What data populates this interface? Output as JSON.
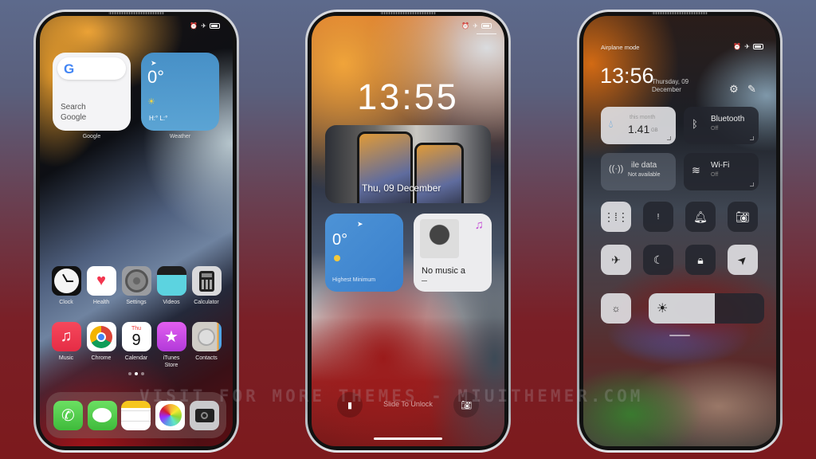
{
  "status_icons": [
    "alarm-icon",
    "airplane-icon",
    "battery-icon"
  ],
  "watermark": "VISIT FOR MORE THEMES - MIUITHEMER.COM",
  "home": {
    "google_widget": {
      "logo": "G",
      "text": "Search\nGoogle",
      "label": "Google"
    },
    "weather_widget": {
      "temp": "0°",
      "hl": "H:° L:°",
      "label": "Weather"
    },
    "apps_row1": [
      {
        "name": "Clock",
        "icon": "clock-icon"
      },
      {
        "name": "Health",
        "icon": "heart-icon"
      },
      {
        "name": "Settings",
        "icon": "gear-icon"
      },
      {
        "name": "Videos",
        "icon": "clapperboard-icon"
      },
      {
        "name": "Calculator",
        "icon": "calculator-icon"
      }
    ],
    "apps_row2": [
      {
        "name": "Music",
        "icon": "music-note-icon"
      },
      {
        "name": "Chrome",
        "icon": "chrome-icon"
      },
      {
        "name": "Calendar",
        "icon": "calendar-icon",
        "day": "Thu",
        "date": "9"
      },
      {
        "name": "iTunes\nStore",
        "icon": "star-icon"
      },
      {
        "name": "Contacts",
        "icon": "contact-icon"
      }
    ],
    "page_dots": {
      "count": 3,
      "active": 2
    },
    "dock": [
      {
        "name": "Phone",
        "icon": "phone-icon"
      },
      {
        "name": "Messages",
        "icon": "message-icon"
      },
      {
        "name": "Notes",
        "icon": "notes-icon"
      },
      {
        "name": "Photos",
        "icon": "photos-icon"
      },
      {
        "name": "Camera",
        "icon": "camera-icon"
      }
    ]
  },
  "lock": {
    "time": "13:55",
    "date": "Thu, 09 December",
    "weather": {
      "temp": "0°",
      "hl": "Highest Minimum"
    },
    "music": {
      "title": "No music a"
    },
    "slide_text": "Slide To Unlock"
  },
  "control_center": {
    "mode": "Airplane mode",
    "time": "13:56",
    "date_line1": "Thursday, 09",
    "date_line2": "December",
    "data_usage": {
      "label": "this month",
      "value": "1.41",
      "unit": "GB"
    },
    "bluetooth": {
      "label": "Bluetooth",
      "status": "Off"
    },
    "mobile_data": {
      "label": "ile data",
      "status": "Not available"
    },
    "wifi": {
      "label": "Wi-Fi",
      "status": "Off"
    },
    "toggles_row1": [
      "sound-wave-icon",
      "vibrate-icon",
      "bell-icon",
      "screenshot-icon"
    ],
    "toggles_row2": [
      "airplane-icon",
      "moon-icon",
      "lock-icon",
      "location-icon"
    ],
    "brightness_percent": 57
  }
}
